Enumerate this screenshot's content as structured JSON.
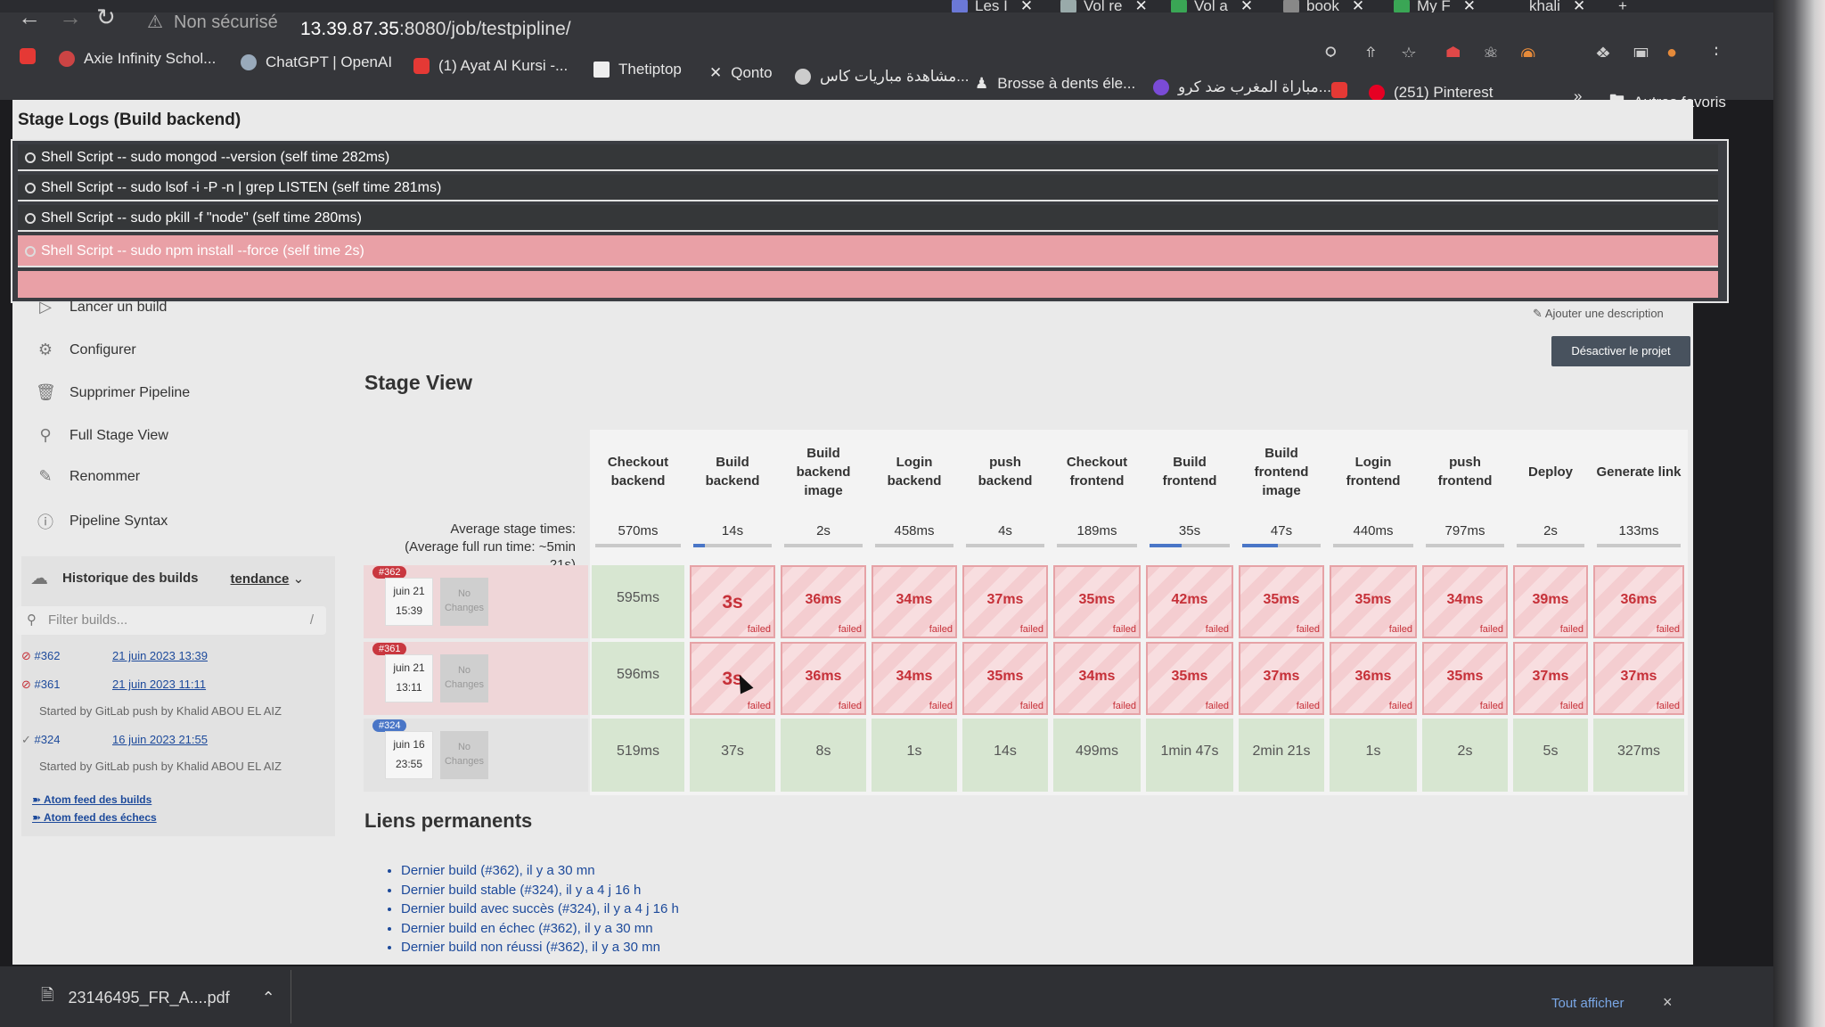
{
  "browser": {
    "tabs": [
      {
        "label": "Les I"
      },
      {
        "label": "Vol re"
      },
      {
        "label": "Vol a"
      },
      {
        "label": "book"
      },
      {
        "label": "My F"
      },
      {
        "label": "khali"
      }
    ],
    "security_label": "Non sécurisé",
    "url_host": "13.39.87.35",
    "url_path": ":8080/job/testpipline/",
    "bookmarks": [
      {
        "label": "Axie Infinity Schol..."
      },
      {
        "label": "ChatGPT | OpenAI"
      },
      {
        "label": "(1) Ayat Al Kursi -..."
      },
      {
        "label": "Thetiptop"
      },
      {
        "label": "Qonto"
      },
      {
        "label": "مشاهدة مباريات كاس..."
      },
      {
        "label": "Brosse à dents éle..."
      },
      {
        "label": "مباراة المغرب ضد كرو..."
      },
      {
        "label": "(251) Pinterest"
      }
    ],
    "more_bookmarks": "»",
    "other_bookmarks": "Autres favoris"
  },
  "logs": {
    "title": "Stage Logs (Build backend)",
    "rows": [
      {
        "text": "Shell Script -- sudo mongod --version (self time 282ms)",
        "status": "ok"
      },
      {
        "text": "Shell Script -- sudo lsof -i -P -n | grep LISTEN (self time 281ms)",
        "status": "ok"
      },
      {
        "text": "Shell Script -- sudo pkill -f \"node\" (self time 280ms)",
        "status": "ok"
      },
      {
        "text": "Shell Script -- sudo npm install --force (self time 2s)",
        "status": "failed"
      }
    ],
    "close": "×"
  },
  "sidebar": {
    "links": [
      {
        "label": "Lancer un build",
        "icon": "play-icon"
      },
      {
        "label": "Configurer",
        "icon": "gear-icon"
      },
      {
        "label": "Supprimer Pipeline",
        "icon": "trash-icon"
      },
      {
        "label": "Full Stage View",
        "icon": "search-icon"
      },
      {
        "label": "Renommer",
        "icon": "pencil-icon"
      },
      {
        "label": "Pipeline Syntax",
        "icon": "help-icon"
      }
    ],
    "history_title": "Historique des builds",
    "history_trend": "tendance",
    "filter_placeholder": "Filter builds...",
    "filter_shortcut": "/",
    "builds": [
      {
        "num": "#362",
        "date": "21 juin 2023 13:39",
        "status": "failed",
        "sub": ""
      },
      {
        "num": "#361",
        "date": "21 juin 2023 11:11",
        "status": "failed",
        "sub": "Started by GitLab push by Khalid ABOU EL AIZ"
      },
      {
        "num": "#324",
        "date": "16 juin 2023 21:55",
        "status": "success",
        "sub": "Started by GitLab push by Khalid ABOU EL AIZ"
      }
    ],
    "atom_all": "Atom feed des builds",
    "atom_fail": "Atom feed des échecs"
  },
  "header": {
    "add_description": "Ajouter une description",
    "disable_button": "Désactiver le projet"
  },
  "stage_view": {
    "title": "Stage View",
    "avg_label_line1": "Average stage times:",
    "avg_label_line2": "(Average full run time: ~5min 21s)",
    "columns": [
      {
        "name": "Checkout backend",
        "avg": "570ms",
        "avg_fraction": 0.0
      },
      {
        "name": "Build backend",
        "avg": "14s",
        "avg_fraction": 0.15
      },
      {
        "name": "Build backend image",
        "avg": "2s",
        "avg_fraction": 0.0
      },
      {
        "name": "Login backend",
        "avg": "458ms",
        "avg_fraction": 0.0
      },
      {
        "name": "push backend",
        "avg": "4s",
        "avg_fraction": 0.0
      },
      {
        "name": "Checkout frontend",
        "avg": "189ms",
        "avg_fraction": 0.0
      },
      {
        "name": "Build frontend",
        "avg": "35s",
        "avg_fraction": 0.4
      },
      {
        "name": "Build frontend image",
        "avg": "47s",
        "avg_fraction": 0.45
      },
      {
        "name": "Login frontend",
        "avg": "440ms",
        "avg_fraction": 0.0
      },
      {
        "name": "push frontend",
        "avg": "797ms",
        "avg_fraction": 0.0
      },
      {
        "name": "Deploy",
        "avg": "2s",
        "avg_fraction": 0.0
      },
      {
        "name": "Generate link",
        "avg": "133ms",
        "avg_fraction": 0.0
      }
    ],
    "failed_label": "failed",
    "builds": [
      {
        "num": "#362",
        "date": "juin 21",
        "time": "15:39",
        "changes": "No Changes",
        "cells": [
          {
            "v": "595ms",
            "s": "ok"
          },
          {
            "v": "3s",
            "s": "failed"
          },
          {
            "v": "36ms",
            "s": "failed"
          },
          {
            "v": "34ms",
            "s": "failed"
          },
          {
            "v": "37ms",
            "s": "failed"
          },
          {
            "v": "35ms",
            "s": "failed"
          },
          {
            "v": "42ms",
            "s": "failed"
          },
          {
            "v": "35ms",
            "s": "failed"
          },
          {
            "v": "35ms",
            "s": "failed"
          },
          {
            "v": "34ms",
            "s": "failed"
          },
          {
            "v": "39ms",
            "s": "failed"
          },
          {
            "v": "36ms",
            "s": "failed"
          }
        ]
      },
      {
        "num": "#361",
        "date": "juin 21",
        "time": "13:11",
        "changes": "No Changes",
        "cells": [
          {
            "v": "596ms",
            "s": "ok"
          },
          {
            "v": "3s",
            "s": "failed"
          },
          {
            "v": "36ms",
            "s": "failed"
          },
          {
            "v": "34ms",
            "s": "failed"
          },
          {
            "v": "35ms",
            "s": "failed"
          },
          {
            "v": "34ms",
            "s": "failed"
          },
          {
            "v": "35ms",
            "s": "failed"
          },
          {
            "v": "37ms",
            "s": "failed"
          },
          {
            "v": "36ms",
            "s": "failed"
          },
          {
            "v": "35ms",
            "s": "failed"
          },
          {
            "v": "37ms",
            "s": "failed"
          },
          {
            "v": "37ms",
            "s": "failed"
          }
        ]
      },
      {
        "num": "#324",
        "date": "juin 16",
        "time": "23:55",
        "changes": "No Changes",
        "cells": [
          {
            "v": "519ms",
            "s": "ok"
          },
          {
            "v": "37s",
            "s": "ok"
          },
          {
            "v": "8s",
            "s": "ok"
          },
          {
            "v": "1s",
            "s": "ok"
          },
          {
            "v": "14s",
            "s": "ok"
          },
          {
            "v": "499ms",
            "s": "ok"
          },
          {
            "v": "1min 47s",
            "s": "ok"
          },
          {
            "v": "2min 21s",
            "s": "ok"
          },
          {
            "v": "1s",
            "s": "ok"
          },
          {
            "v": "2s",
            "s": "ok"
          },
          {
            "v": "5s",
            "s": "ok"
          },
          {
            "v": "327ms",
            "s": "ok"
          }
        ]
      }
    ]
  },
  "permalinks": {
    "title": "Liens permanents",
    "items": [
      "Dernier build (#362), il y a 30 mn",
      "Dernier build stable (#324), il y a 4 j 16 h",
      "Dernier build avec succès (#324), il y a 4 j 16 h",
      "Dernier build en échec (#362), il y a 30 mn",
      "Dernier build non réussi (#362), il y a 30 mn"
    ]
  },
  "downloads": {
    "file": "23146495_FR_A....pdf",
    "show_all": "Tout afficher",
    "close": "×"
  },
  "colors": {
    "failed_text": "#c63038",
    "success_bg": "#d7e6d1",
    "link": "#1d4a9b",
    "accent_bar": "#4a76c7"
  }
}
